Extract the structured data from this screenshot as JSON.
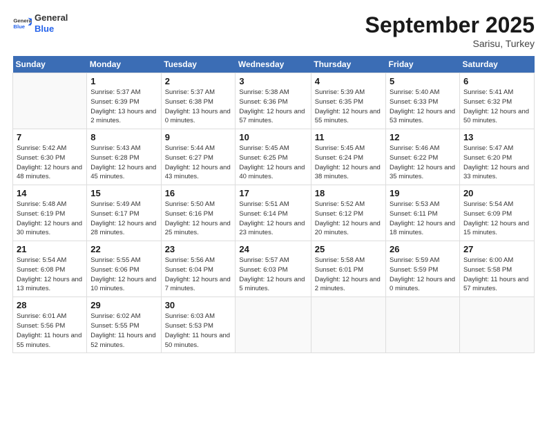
{
  "logo": {
    "general": "General",
    "blue": "Blue"
  },
  "header": {
    "month": "September 2025",
    "location": "Sarisu, Turkey"
  },
  "weekdays": [
    "Sunday",
    "Monday",
    "Tuesday",
    "Wednesday",
    "Thursday",
    "Friday",
    "Saturday"
  ],
  "weeks": [
    [
      {
        "day": "",
        "empty": true
      },
      {
        "day": "1",
        "sunrise": "5:37 AM",
        "sunset": "6:39 PM",
        "daylight": "13 hours and 2 minutes."
      },
      {
        "day": "2",
        "sunrise": "5:37 AM",
        "sunset": "6:38 PM",
        "daylight": "13 hours and 0 minutes."
      },
      {
        "day": "3",
        "sunrise": "5:38 AM",
        "sunset": "6:36 PM",
        "daylight": "12 hours and 57 minutes."
      },
      {
        "day": "4",
        "sunrise": "5:39 AM",
        "sunset": "6:35 PM",
        "daylight": "12 hours and 55 minutes."
      },
      {
        "day": "5",
        "sunrise": "5:40 AM",
        "sunset": "6:33 PM",
        "daylight": "12 hours and 53 minutes."
      },
      {
        "day": "6",
        "sunrise": "5:41 AM",
        "sunset": "6:32 PM",
        "daylight": "12 hours and 50 minutes."
      }
    ],
    [
      {
        "day": "7",
        "sunrise": "5:42 AM",
        "sunset": "6:30 PM",
        "daylight": "12 hours and 48 minutes."
      },
      {
        "day": "8",
        "sunrise": "5:43 AM",
        "sunset": "6:28 PM",
        "daylight": "12 hours and 45 minutes."
      },
      {
        "day": "9",
        "sunrise": "5:44 AM",
        "sunset": "6:27 PM",
        "daylight": "12 hours and 43 minutes."
      },
      {
        "day": "10",
        "sunrise": "5:45 AM",
        "sunset": "6:25 PM",
        "daylight": "12 hours and 40 minutes."
      },
      {
        "day": "11",
        "sunrise": "5:45 AM",
        "sunset": "6:24 PM",
        "daylight": "12 hours and 38 minutes."
      },
      {
        "day": "12",
        "sunrise": "5:46 AM",
        "sunset": "6:22 PM",
        "daylight": "12 hours and 35 minutes."
      },
      {
        "day": "13",
        "sunrise": "5:47 AM",
        "sunset": "6:20 PM",
        "daylight": "12 hours and 33 minutes."
      }
    ],
    [
      {
        "day": "14",
        "sunrise": "5:48 AM",
        "sunset": "6:19 PM",
        "daylight": "12 hours and 30 minutes."
      },
      {
        "day": "15",
        "sunrise": "5:49 AM",
        "sunset": "6:17 PM",
        "daylight": "12 hours and 28 minutes."
      },
      {
        "day": "16",
        "sunrise": "5:50 AM",
        "sunset": "6:16 PM",
        "daylight": "12 hours and 25 minutes."
      },
      {
        "day": "17",
        "sunrise": "5:51 AM",
        "sunset": "6:14 PM",
        "daylight": "12 hours and 23 minutes."
      },
      {
        "day": "18",
        "sunrise": "5:52 AM",
        "sunset": "6:12 PM",
        "daylight": "12 hours and 20 minutes."
      },
      {
        "day": "19",
        "sunrise": "5:53 AM",
        "sunset": "6:11 PM",
        "daylight": "12 hours and 18 minutes."
      },
      {
        "day": "20",
        "sunrise": "5:54 AM",
        "sunset": "6:09 PM",
        "daylight": "12 hours and 15 minutes."
      }
    ],
    [
      {
        "day": "21",
        "sunrise": "5:54 AM",
        "sunset": "6:08 PM",
        "daylight": "12 hours and 13 minutes."
      },
      {
        "day": "22",
        "sunrise": "5:55 AM",
        "sunset": "6:06 PM",
        "daylight": "12 hours and 10 minutes."
      },
      {
        "day": "23",
        "sunrise": "5:56 AM",
        "sunset": "6:04 PM",
        "daylight": "12 hours and 7 minutes."
      },
      {
        "day": "24",
        "sunrise": "5:57 AM",
        "sunset": "6:03 PM",
        "daylight": "12 hours and 5 minutes."
      },
      {
        "day": "25",
        "sunrise": "5:58 AM",
        "sunset": "6:01 PM",
        "daylight": "12 hours and 2 minutes."
      },
      {
        "day": "26",
        "sunrise": "5:59 AM",
        "sunset": "5:59 PM",
        "daylight": "12 hours and 0 minutes."
      },
      {
        "day": "27",
        "sunrise": "6:00 AM",
        "sunset": "5:58 PM",
        "daylight": "11 hours and 57 minutes."
      }
    ],
    [
      {
        "day": "28",
        "sunrise": "6:01 AM",
        "sunset": "5:56 PM",
        "daylight": "11 hours and 55 minutes."
      },
      {
        "day": "29",
        "sunrise": "6:02 AM",
        "sunset": "5:55 PM",
        "daylight": "11 hours and 52 minutes."
      },
      {
        "day": "30",
        "sunrise": "6:03 AM",
        "sunset": "5:53 PM",
        "daylight": "11 hours and 50 minutes."
      },
      {
        "day": "",
        "empty": true
      },
      {
        "day": "",
        "empty": true
      },
      {
        "day": "",
        "empty": true
      },
      {
        "day": "",
        "empty": true
      }
    ]
  ]
}
